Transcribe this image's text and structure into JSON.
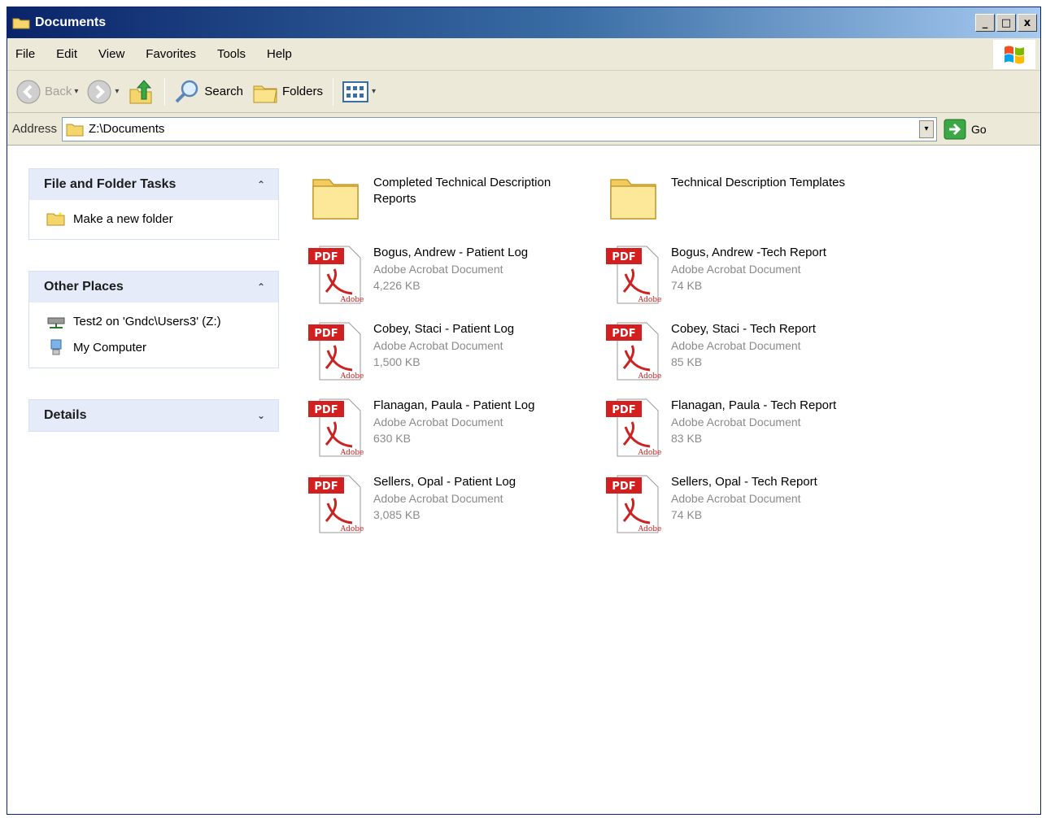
{
  "window": {
    "title": "Documents",
    "minimize": "_",
    "maximize": "□",
    "close": "x"
  },
  "menu": [
    "File",
    "Edit",
    "View",
    "Favorites",
    "Tools",
    "Help"
  ],
  "toolbar": {
    "back": "Back",
    "search": "Search",
    "folders": "Folders"
  },
  "address": {
    "label": "Address",
    "value": "Z:\\Documents",
    "go": "Go"
  },
  "panels": {
    "tasks": {
      "title": "File and Folder Tasks",
      "items": [
        "Make a new folder"
      ]
    },
    "places": {
      "title": "Other Places",
      "items": [
        "Test2 on 'Gndc\\Users3' (Z:)",
        "My Computer"
      ]
    },
    "details": {
      "title": "Details"
    }
  },
  "files": [
    {
      "name": "Completed Technical Description Reports",
      "kind": "folder"
    },
    {
      "name": "Technical Description Templates",
      "kind": "folder"
    },
    {
      "name": "Bogus, Andrew - Patient Log",
      "type": "Adobe Acrobat Document",
      "size": "4,226 KB",
      "kind": "pdf"
    },
    {
      "name": "Bogus, Andrew -Tech Report",
      "type": "Adobe Acrobat Document",
      "size": "74 KB",
      "kind": "pdf"
    },
    {
      "name": "Cobey, Staci - Patient Log",
      "type": "Adobe Acrobat Document",
      "size": "1,500 KB",
      "kind": "pdf"
    },
    {
      "name": "Cobey, Staci - Tech Report",
      "type": "Adobe Acrobat Document",
      "size": "85 KB",
      "kind": "pdf"
    },
    {
      "name": "Flanagan, Paula - Patient Log",
      "type": "Adobe Acrobat Document",
      "size": "630 KB",
      "kind": "pdf"
    },
    {
      "name": "Flanagan, Paula - Tech Report",
      "type": "Adobe Acrobat Document",
      "size": "83 KB",
      "kind": "pdf"
    },
    {
      "name": "Sellers, Opal - Patient Log",
      "type": "Adobe Acrobat Document",
      "size": "3,085 KB",
      "kind": "pdf"
    },
    {
      "name": "Sellers, Opal - Tech Report",
      "type": "Adobe Acrobat Document",
      "size": "74 KB",
      "kind": "pdf"
    }
  ]
}
